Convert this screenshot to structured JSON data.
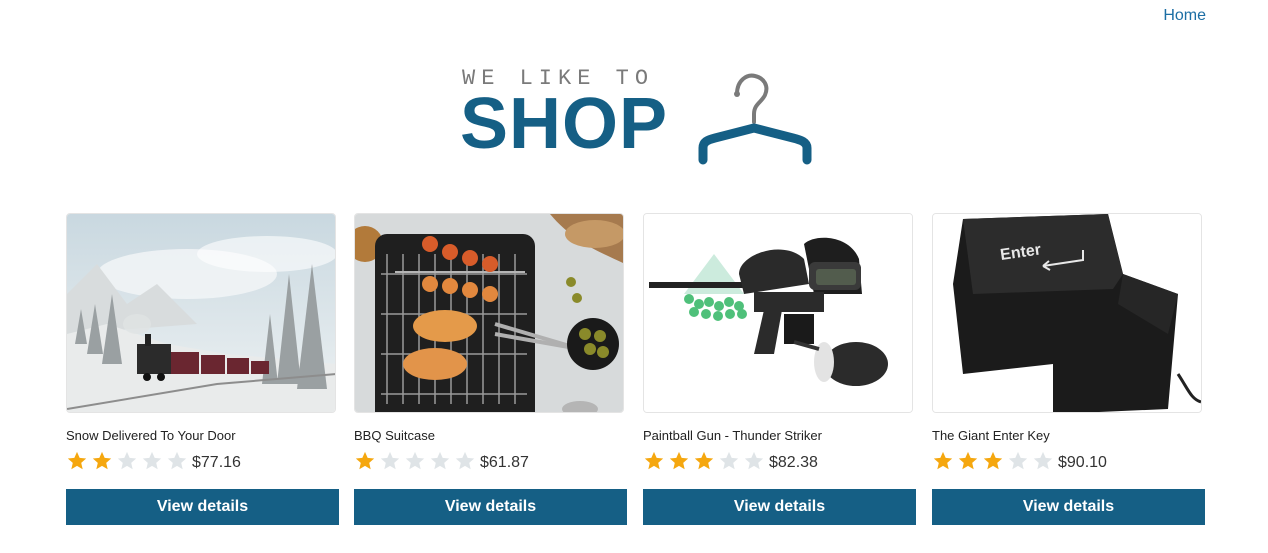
{
  "nav": {
    "home_label": "Home"
  },
  "logo": {
    "tagline": "WE LIKE TO",
    "brand": "SHOP"
  },
  "colors": {
    "accent": "#155f85",
    "star_filled": "#f5a70f",
    "star_empty": "#dfe4e7",
    "link": "#1c6ea4"
  },
  "products": [
    {
      "name": "Snow Delivered To Your Door",
      "rating": 2,
      "max_rating": 5,
      "price": "$77.16",
      "button_label": "View details",
      "image_icon": "snowy-train-image"
    },
    {
      "name": "BBQ Suitcase",
      "rating": 1,
      "max_rating": 5,
      "price": "$61.87",
      "button_label": "View details",
      "image_icon": "bbq-grill-image"
    },
    {
      "name": "Paintball Gun - Thunder Striker",
      "rating": 3,
      "max_rating": 5,
      "price": "$82.38",
      "button_label": "View details",
      "image_icon": "paintball-gun-image"
    },
    {
      "name": "The Giant Enter Key",
      "rating": 3,
      "max_rating": 5,
      "price": "$90.10",
      "button_label": "View details",
      "image_icon": "enter-key-image",
      "image_text": "Enter"
    }
  ]
}
